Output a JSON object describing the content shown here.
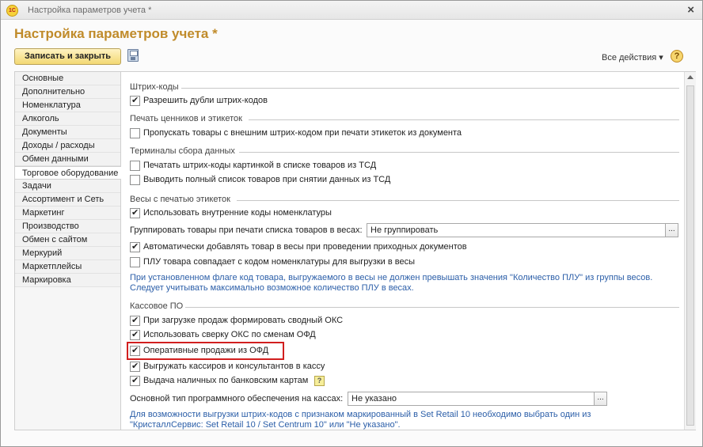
{
  "window": {
    "title": "Настройка параметров учета *",
    "app_logo": "1С"
  },
  "page_title": "Настройка параметров учета *",
  "toolbar": {
    "save_close_label": "Записать и закрыть",
    "all_actions_label": "Все действия ▾",
    "help_label": "?"
  },
  "sidebar": {
    "items": [
      {
        "label": "Основные"
      },
      {
        "label": "Дополнительно"
      },
      {
        "label": "Номенклатура"
      },
      {
        "label": "Алкоголь"
      },
      {
        "label": "Документы"
      },
      {
        "label": "Доходы / расходы"
      },
      {
        "label": "Обмен данными"
      },
      {
        "label": "Торговое оборудование",
        "active": true
      },
      {
        "label": "Задачи"
      },
      {
        "label": "Ассортимент и Сеть"
      },
      {
        "label": "Маркетинг"
      },
      {
        "label": "Производство"
      },
      {
        "label": "Обмен с сайтом"
      },
      {
        "label": "Меркурий"
      },
      {
        "label": "Маркетплейсы"
      },
      {
        "label": "Маркировка"
      }
    ]
  },
  "groups": {
    "barcodes": {
      "title": "Штрих-коды",
      "allow_duplicates": {
        "label": "Разрешить дубли штрих-кодов",
        "checked": true
      }
    },
    "labels": {
      "title": "Печать ценников и этикеток",
      "skip_external": {
        "label": "Пропускать товары с внешним штрих-кодом при печати этикеток из документа",
        "checked": false
      }
    },
    "terminals": {
      "title": "Терминалы сбора данных",
      "print_as_picture": {
        "label": "Печатать штрих-коды картинкой в списке товаров из ТСД",
        "checked": false
      },
      "full_list": {
        "label": "Выводить полный список товаров при снятии данных из ТСД",
        "checked": false
      }
    },
    "scales": {
      "title": "Весы с печатью этикеток",
      "internal_codes": {
        "label": "Использовать внутренние коды номенклатуры",
        "checked": true
      },
      "group_label": "Группировать товары при печати списка товаров в весах:",
      "group_value": "Не группировать",
      "auto_add": {
        "label": "Автоматически добавлять товар в весы при проведении приходных документов",
        "checked": true
      },
      "plu_match": {
        "label": "ПЛУ товара совпадает с кодом номенклатуры для выгрузки в весы",
        "checked": false
      },
      "info_line1": "При установленном флаге код товара, выгружаемого в весы не должен превышать значения \"Количество ПЛУ\" из группы весов.",
      "info_line2": "Следует учитывать максимально возможное количество ПЛУ в весах."
    },
    "pos": {
      "title": "Кассовое ПО",
      "summary_oks": {
        "label": "При загрузке продаж формировать сводный ОКС",
        "checked": true
      },
      "oks_reconcile": {
        "label": "Использовать сверку ОКС по сменам ОФД",
        "checked": true
      },
      "ofd_sales": {
        "label": "Оперативные продажи из ОФД",
        "checked": true
      },
      "export_cashiers": {
        "label": "Выгружать кассиров и консультантов в кассу",
        "checked": true
      },
      "cash_withdraw": {
        "label": "Выдача наличных по банковским картам",
        "checked": true
      },
      "software_label": "Основной тип программного обеспечения на кассах:",
      "software_value": "Не указано",
      "info_line1": "Для возможности выгрузки штрих-кодов с признаком маркированный в Set Retail 10 необходимо выбрать один из",
      "info_line2": "\"КристаллСервис: Set Retail 10 / Set Centrum 10\" или \"Не указано\"."
    }
  },
  "dots_label": "...",
  "colors": {
    "title": "#c08b2a",
    "info": "#2b5ea8",
    "highlight": "#d11f1f"
  }
}
